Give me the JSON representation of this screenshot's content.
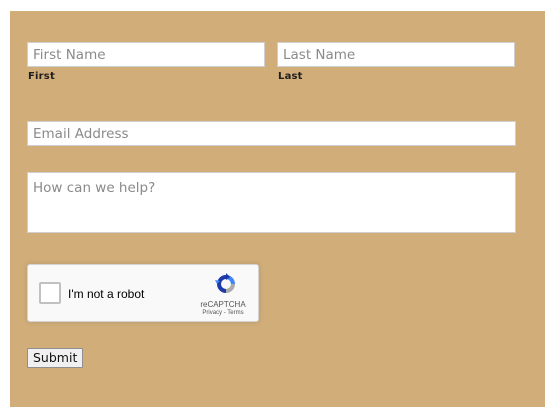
{
  "form": {
    "first_name": {
      "placeholder": "First Name",
      "value": "",
      "sublabel": "First"
    },
    "last_name": {
      "placeholder": "Last Name",
      "value": "",
      "sublabel": "Last"
    },
    "email": {
      "placeholder": "Email Address",
      "value": ""
    },
    "message": {
      "placeholder": "How can we help?",
      "value": ""
    },
    "recaptcha": {
      "label": "I'm not a robot",
      "brand": "reCAPTCHA",
      "privacy": "Privacy",
      "separator": " - ",
      "terms": "Terms",
      "logo_icon": "recaptcha-logo-icon",
      "checked": false
    },
    "submit_label": "Submit"
  },
  "colors": {
    "background": "#d0ad79",
    "input_bg": "#ffffff",
    "recaptcha_bg": "#f9f9f9",
    "recaptcha_blue": "#1c3aa9",
    "recaptcha_lightblue": "#4285f4",
    "recaptcha_gray": "#ababab"
  }
}
